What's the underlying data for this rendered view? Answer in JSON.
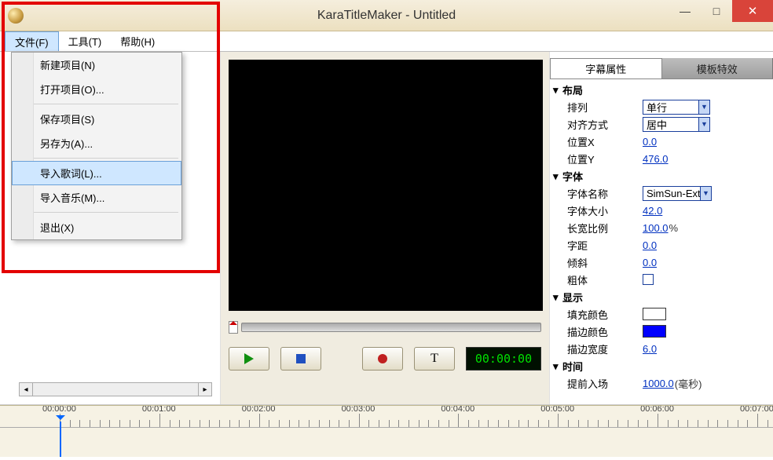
{
  "window": {
    "title": "KaraTitleMaker - Untitled"
  },
  "menubar": {
    "file": "文件(F)",
    "tools": "工具(T)",
    "help": "帮助(H)"
  },
  "file_menu": {
    "new_project": "新建项目(N)",
    "open_project": "打开项目(O)...",
    "save_project": "保存项目(S)",
    "save_as": "另存为(A)...",
    "import_lyrics": "导入歌词(L)...",
    "import_music": "导入音乐(M)...",
    "exit": "退出(X)"
  },
  "transport": {
    "timecode": "00:00:00"
  },
  "tabs": {
    "subtitle_props": "字幕属性",
    "template_fx": "模板特效"
  },
  "props": {
    "sections": {
      "layout": "布局",
      "font": "字体",
      "display": "显示",
      "time": "时间"
    },
    "labels": {
      "arrangement": "排列",
      "alignment": "对齐方式",
      "pos_x": "位置X",
      "pos_y": "位置Y",
      "font_name": "字体名称",
      "font_size": "字体大小",
      "aspect": "长宽比例",
      "spacing": "字距",
      "skew": "倾斜",
      "bold": "粗体",
      "fill_color": "填充颜色",
      "stroke_color": "描边颜色",
      "stroke_width": "描边宽度",
      "lead_in": "提前入场"
    },
    "values": {
      "arrangement": "单行",
      "alignment": "居中",
      "pos_x": "0.0",
      "pos_y": "476.0",
      "font_name": "SimSun-Ext",
      "font_size": "42.0",
      "aspect": "100.0",
      "aspect_suffix": "%",
      "spacing": "0.0",
      "skew": "0.0",
      "fill_color": "#ffffff",
      "stroke_color": "#0000ff",
      "stroke_width": "6.0",
      "lead_in": "1000.0",
      "lead_in_suffix": "(毫秒)"
    }
  },
  "timeline": {
    "marks": [
      "00:00:00",
      "00:01:00",
      "00:02:00",
      "00:03:00",
      "00:04:00",
      "00:05:00",
      "00:06:00",
      "00:07:00"
    ]
  }
}
